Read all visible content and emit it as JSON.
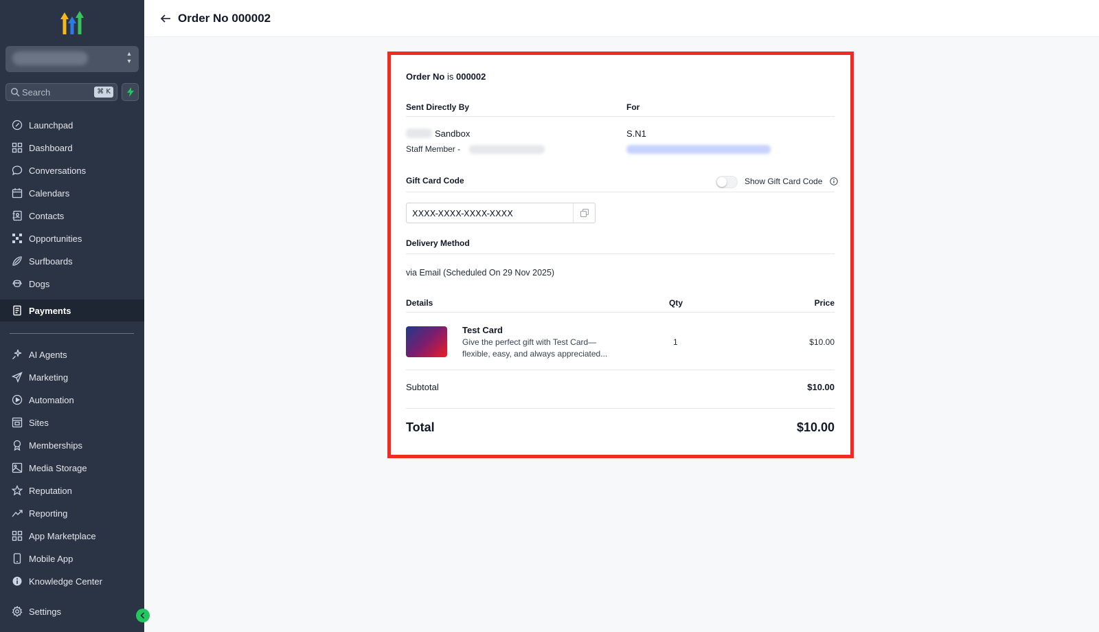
{
  "sidebar": {
    "search": {
      "label": "Search",
      "shortcut": "⌘ K"
    },
    "items": [
      {
        "label": "Launchpad",
        "icon": "rocket-icon"
      },
      {
        "label": "Dashboard",
        "icon": "grid-icon"
      },
      {
        "label": "Conversations",
        "icon": "chat-icon"
      },
      {
        "label": "Calendars",
        "icon": "calendar-icon"
      },
      {
        "label": "Contacts",
        "icon": "contacts-icon"
      },
      {
        "label": "Opportunities",
        "icon": "network-icon"
      },
      {
        "label": "Surfboards",
        "icon": "surfboard-icon"
      },
      {
        "label": "Dogs",
        "icon": "dog-icon"
      },
      {
        "label": "Payments",
        "icon": "receipt-icon",
        "active": true
      },
      {
        "label": "AI Agents",
        "icon": "sparkle-icon"
      },
      {
        "label": "Marketing",
        "icon": "send-icon"
      },
      {
        "label": "Automation",
        "icon": "automation-icon"
      },
      {
        "label": "Sites",
        "icon": "sites-icon"
      },
      {
        "label": "Memberships",
        "icon": "award-icon"
      },
      {
        "label": "Media Storage",
        "icon": "image-icon"
      },
      {
        "label": "Reputation",
        "icon": "star-icon"
      },
      {
        "label": "Reporting",
        "icon": "trend-icon"
      },
      {
        "label": "App Marketplace",
        "icon": "apps-icon"
      },
      {
        "label": "Mobile App",
        "icon": "phone-icon"
      },
      {
        "label": "Knowledge Center",
        "icon": "info-icon"
      },
      {
        "label": "Settings",
        "icon": "gear-icon"
      }
    ]
  },
  "header": {
    "title": "Order No 000002"
  },
  "order": {
    "order_prefix": "Order No",
    "order_is": "is",
    "order_number": "000002",
    "sent_by_label": "Sent Directly By",
    "for_label": "For",
    "sender_name": "Sandbox",
    "staff_label": "Staff Member -",
    "recipient_name": "S.N1",
    "gift_card_label": "Gift Card Code",
    "show_code_label": "Show Gift Card Code",
    "gift_card_code": "XXXX-XXXX-XXXX-XXXX",
    "delivery_label": "Delivery Method",
    "delivery_value": "via Email (Scheduled On 29 Nov 2025)",
    "columns": {
      "details": "Details",
      "qty": "Qty",
      "price": "Price"
    },
    "item": {
      "name": "Test Card",
      "desc_line1": "Give the perfect gift with Test Card—",
      "desc_line2": "flexible, easy, and always appreciated...",
      "qty": "1",
      "price": "$10.00"
    },
    "subtotal_label": "Subtotal",
    "subtotal_value": "$10.00",
    "total_label": "Total",
    "total_value": "$10.00"
  },
  "colors": {
    "sidebar_bg": "#2b3444",
    "highlight": "#ef2b22",
    "accent_green": "#22c55e"
  }
}
